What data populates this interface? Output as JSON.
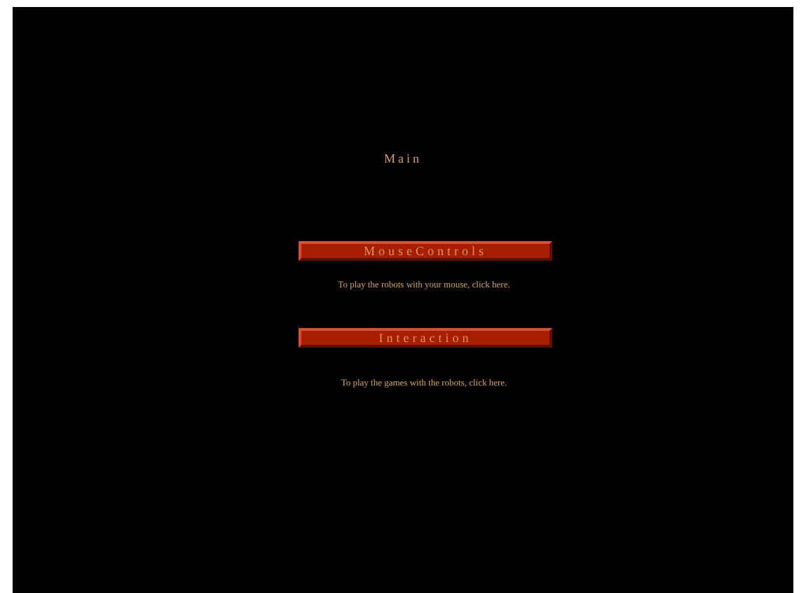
{
  "title": "Main",
  "options": [
    {
      "label": "MouseControls",
      "description": "To play the robots with your mouse, click here."
    },
    {
      "label": "Interaction",
      "description": "To play the games with the robots, click here."
    }
  ]
}
